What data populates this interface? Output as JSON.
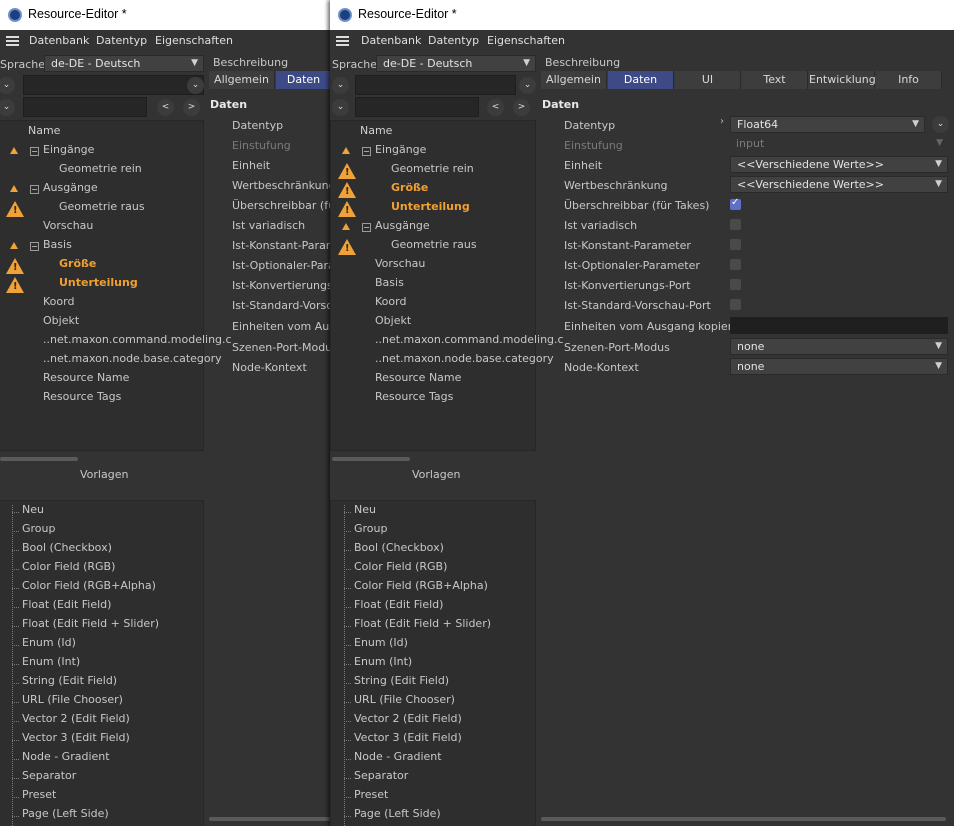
{
  "app": {
    "title": "Resource-Editor *"
  },
  "menu": [
    "Datenbank",
    "Datentyp",
    "Eigenschaften"
  ],
  "language": {
    "label": "Sprache",
    "value": "de-DE - Deutsch"
  },
  "description_label": "Beschreibung",
  "tree": {
    "header": "Name",
    "left_rows": [
      {
        "label": "Eingänge",
        "orange": false
      },
      {
        "label": "Geometrie rein",
        "orange": false
      },
      {
        "label": "Ausgänge",
        "orange": false
      },
      {
        "label": "Geometrie raus",
        "orange": false
      },
      {
        "label": "Vorschau",
        "orange": false
      },
      {
        "label": "Basis",
        "orange": false
      },
      {
        "label": "Größe",
        "orange": true
      },
      {
        "label": "Unterteilung",
        "orange": true
      },
      {
        "label": "Koord",
        "orange": false
      },
      {
        "label": "Objekt",
        "orange": false
      },
      {
        "label": "..net.maxon.command.modeling.c",
        "orange": false
      },
      {
        "label": "..net.maxon.node.base.category",
        "orange": false
      },
      {
        "label": "Resource Name",
        "orange": false
      },
      {
        "label": "Resource Tags",
        "orange": false
      }
    ],
    "right_rows": [
      {
        "label": "Eingänge",
        "orange": false
      },
      {
        "label": "Geometrie rein",
        "orange": false
      },
      {
        "label": "Größe",
        "orange": true
      },
      {
        "label": "Unterteilung",
        "orange": true
      },
      {
        "label": "Ausgänge",
        "orange": false
      },
      {
        "label": "Geometrie raus",
        "orange": false
      },
      {
        "label": "Vorschau",
        "orange": false
      },
      {
        "label": "Basis",
        "orange": false
      },
      {
        "label": "Koord",
        "orange": false
      },
      {
        "label": "Objekt",
        "orange": false
      },
      {
        "label": "..net.maxon.command.modeling.c",
        "orange": false
      },
      {
        "label": "..net.maxon.node.base.category",
        "orange": false
      },
      {
        "label": "Resource Name",
        "orange": false
      },
      {
        "label": "Resource Tags",
        "orange": false
      }
    ]
  },
  "templates": {
    "label": "Vorlagen",
    "items": [
      "Neu",
      "Group",
      "Bool (Checkbox)",
      "Color Field (RGB)",
      "Color Field (RGB+Alpha)",
      "Float (Edit Field)",
      "Float (Edit Field + Slider)",
      "Enum (Id)",
      "Enum (Int)",
      "String (Edit Field)",
      "URL (File Chooser)",
      "Vector 2 (Edit Field)",
      "Vector 3 (Edit Field)",
      "Node - Gradient",
      "Separator",
      "Preset",
      "Page (Left Side)"
    ]
  },
  "tabs": [
    "Allgemein",
    "Daten",
    "UI",
    "Text",
    "Entwicklung",
    "Info"
  ],
  "left_tabs": [
    "Allgemein",
    "Daten"
  ],
  "section": "Daten",
  "left_props": [
    "Datentyp",
    "Einstufung",
    "Einheit",
    "Wertbeschränkung",
    "Überschreibbar (für Ta",
    "Ist variadisch",
    "Ist-Konstant-Parame",
    "Ist-Optionaler-Param",
    "Ist-Konvertierungs-P",
    "Ist-Standard-Vorscha",
    "Einheiten vom Ausga",
    "Szenen-Port-Modus",
    "Node-Kontext"
  ],
  "props": {
    "datentyp": {
      "label": "Datentyp",
      "value": "Float64"
    },
    "einstufung": {
      "label": "Einstufung",
      "value": "input"
    },
    "einheit": {
      "label": "Einheit",
      "value": "<<Verschiedene Werte>>"
    },
    "wertbeschraenkung": {
      "label": "Wertbeschränkung",
      "value": "<<Verschiedene Werte>>"
    },
    "ueberschreibbar": {
      "label": "Überschreibbar (für Takes)",
      "checked": true
    },
    "variadisch": {
      "label": "Ist variadisch",
      "checked": false
    },
    "konstant": {
      "label": "Ist-Konstant-Parameter",
      "checked": false
    },
    "optional": {
      "label": "Ist-Optionaler-Parameter",
      "checked": false
    },
    "konvertierung": {
      "label": "Ist-Konvertierungs-Port",
      "checked": false
    },
    "vorschau": {
      "label": "Ist-Standard-Vorschau-Port",
      "checked": false
    },
    "einheiten_kopieren": {
      "label": "Einheiten vom Ausgang kopieren"
    },
    "szenen_port": {
      "label": "Szenen-Port-Modus",
      "value": "none"
    },
    "node_kontext": {
      "label": "Node-Kontext",
      "value": "none"
    }
  }
}
